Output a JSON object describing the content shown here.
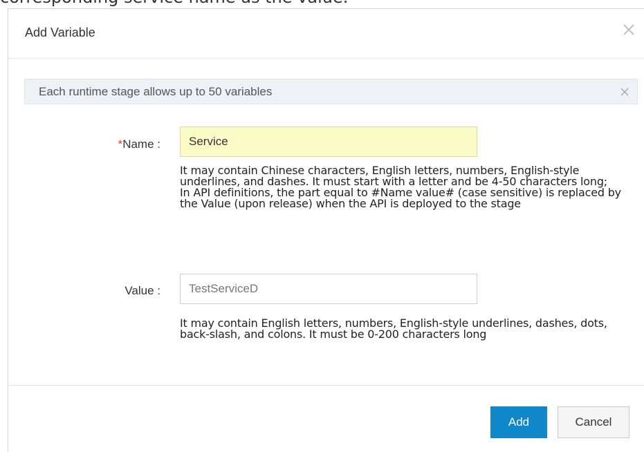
{
  "background": {
    "partial_text": "corresponding service name as the value."
  },
  "dialog": {
    "title": "Add Variable",
    "info_message": "Each runtime stage allows up to 50 variables",
    "form": {
      "name": {
        "required_mark": "*",
        "label": "Name :",
        "value": "Service",
        "help": [
          "It may contain Chinese characters, English letters, numbers, English-style underlines, and dashes. It must start with a letter and be 4-50 characters long;",
          "In API definitions, the part equal to #Name value# (case sensitive) is replaced by the Value (upon release) when the API is deployed to the stage"
        ]
      },
      "value": {
        "label": "Value :",
        "placeholder": "TestServiceD",
        "help": "It may contain English letters, numbers, English-style underlines, dashes, dots, back-slash, and colons. It must be 0-200 characters long"
      }
    },
    "buttons": {
      "add": "Add",
      "cancel": "Cancel"
    }
  },
  "colors": {
    "primary": "#0f87c9",
    "required": "#e4393c",
    "highlight_input": "#fafcc8",
    "info_bar": "#eef1f5"
  }
}
